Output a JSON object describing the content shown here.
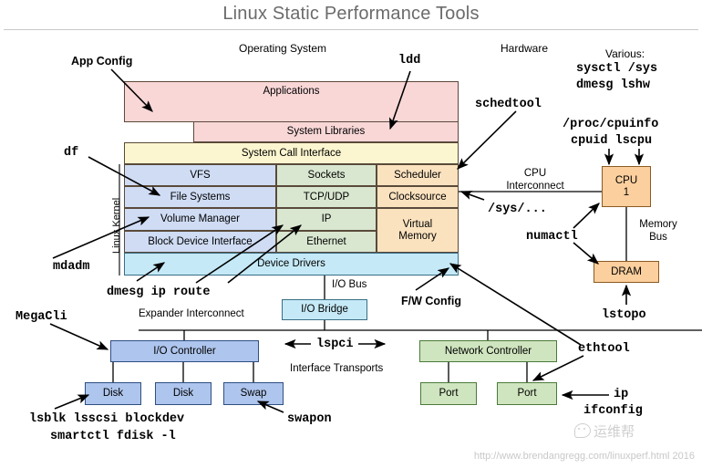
{
  "header": {
    "title": "Linux Static Performance Tools"
  },
  "sections": {
    "operating_system": "Operating System",
    "hardware": "Hardware",
    "various": "Various:",
    "linux_kernel": "Linux Kernel"
  },
  "os_stack": {
    "applications": "Applications",
    "system_libraries": "System Libraries",
    "system_call_interface": "System Call Interface",
    "vfs": "VFS",
    "file_systems": "File Systems",
    "volume_manager": "Volume Manager",
    "block_device_interface": "Block Device Interface",
    "sockets": "Sockets",
    "tcp_udp": "TCP/UDP",
    "ip": "IP",
    "ethernet": "Ethernet",
    "scheduler": "Scheduler",
    "clocksource": "Clocksource",
    "virtual_memory": "Virtual\nMemory",
    "virtual_memory_line1": "Virtual",
    "virtual_memory_line2": "Memory",
    "device_drivers": "Device Drivers"
  },
  "hardware_blocks": {
    "cpu_line1": "CPU",
    "cpu_line2": "1",
    "dram": "DRAM",
    "io_bridge": "I/O Bridge",
    "io_controller": "I/O Controller",
    "disk_1": "Disk",
    "disk_2": "Disk",
    "swap": "Swap",
    "network_controller": "Network Controller",
    "port_1": "Port",
    "port_2": "Port"
  },
  "bus_labels": {
    "cpu_interconnect_l1": "CPU",
    "cpu_interconnect_l2": "Interconnect",
    "memory_bus_l1": "Memory",
    "memory_bus_l2": "Bus",
    "io_bus": "I/O Bus",
    "expander_interconnect": "Expander Interconnect",
    "interface_transports": "Interface Transports"
  },
  "tools": {
    "app_config": "App Config",
    "ldd": "ldd",
    "schedtool": "schedtool",
    "sysctl_sys": "sysctl /sys",
    "dmesg_lshw": "dmesg lshw",
    "proc_cpuinfo": "/proc/cpuinfo",
    "cpuid_lscpu": "cpuid lscpu",
    "sys_dots": "/sys/...",
    "numactl": "numactl",
    "lstopo": "lstopo",
    "df": "df",
    "mdadm": "mdadm",
    "dmesg_ip_route": "dmesg ip route",
    "megacli": "MegaCli",
    "lsblk_line": "lsblk lsscsi blockdev",
    "smartctl_line": "smartctl fdisk -l",
    "swapon": "swapon",
    "lspci": "lspci",
    "fw_config": "F/W Config",
    "ethtool": "ethtool",
    "ip": "ip",
    "ifconfig": "ifconfig"
  },
  "footer": {
    "url": "http://www.brendangregg.com/linuxperf.html 2016",
    "watermark": "运维帮"
  },
  "colors": {
    "pink": "#f9d7d7",
    "yellow": "#fbf6cf",
    "blue": "#cfdcf4",
    "green": "#d9e7d0",
    "orange": "#fbe2bf",
    "cyan": "#c5e9f7",
    "io_blue": "#aec5ed",
    "net_green": "#cfe5bf",
    "cpu_orange": "#fbcf9e",
    "title_gray": "#6b6b6b"
  }
}
